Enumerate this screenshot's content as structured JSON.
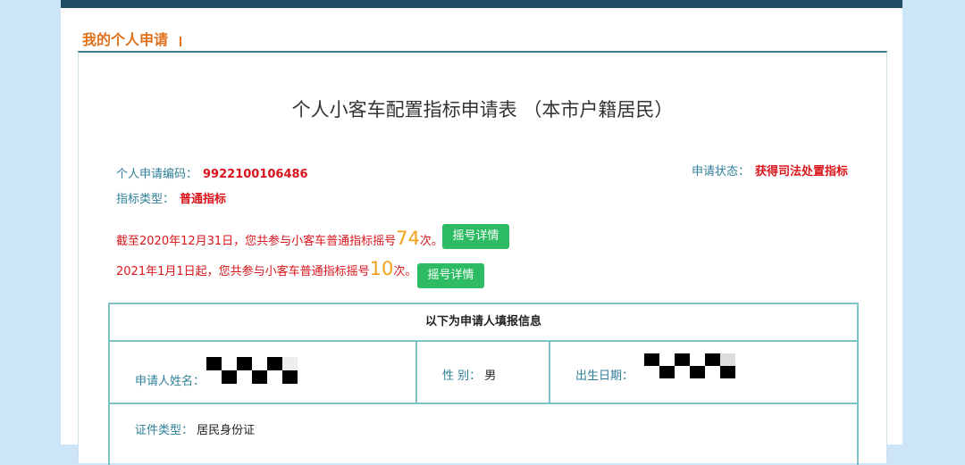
{
  "section": {
    "title": "我的个人申请"
  },
  "form": {
    "title": "个人小客车配置指标申请表 （本市户籍居民）",
    "code_label": "个人申请编码：",
    "code_value": "9922100106486",
    "type_label": "指标类型：",
    "type_value": "普通指标",
    "status_label": "申请状态：",
    "status_value": "获得司法处置指标"
  },
  "lottery": {
    "line1_prefix": "截至2020年12月31日，您共参与小客车普通指标摇号",
    "line1_count": "74",
    "line1_suffix": "次。",
    "line2_prefix": "2021年1月1日起，您共参与小客车普通指标摇号",
    "line2_count": "10",
    "line2_suffix": "次。",
    "details_button": "摇号详情"
  },
  "applicant": {
    "header": "以下为申请人填报信息",
    "name_label": "申请人姓名：",
    "gender_label": "性  别：",
    "gender_value": "男",
    "birth_label": "出生日期：",
    "id_type_label": "证件类型：",
    "id_type_value": "居民身份证"
  },
  "colors": {
    "accent_orange": "#e0701c",
    "label_teal": "#2f7f99",
    "value_red": "#d9141b",
    "count_gold": "#f3a21b",
    "button_green": "#2dbb63"
  }
}
